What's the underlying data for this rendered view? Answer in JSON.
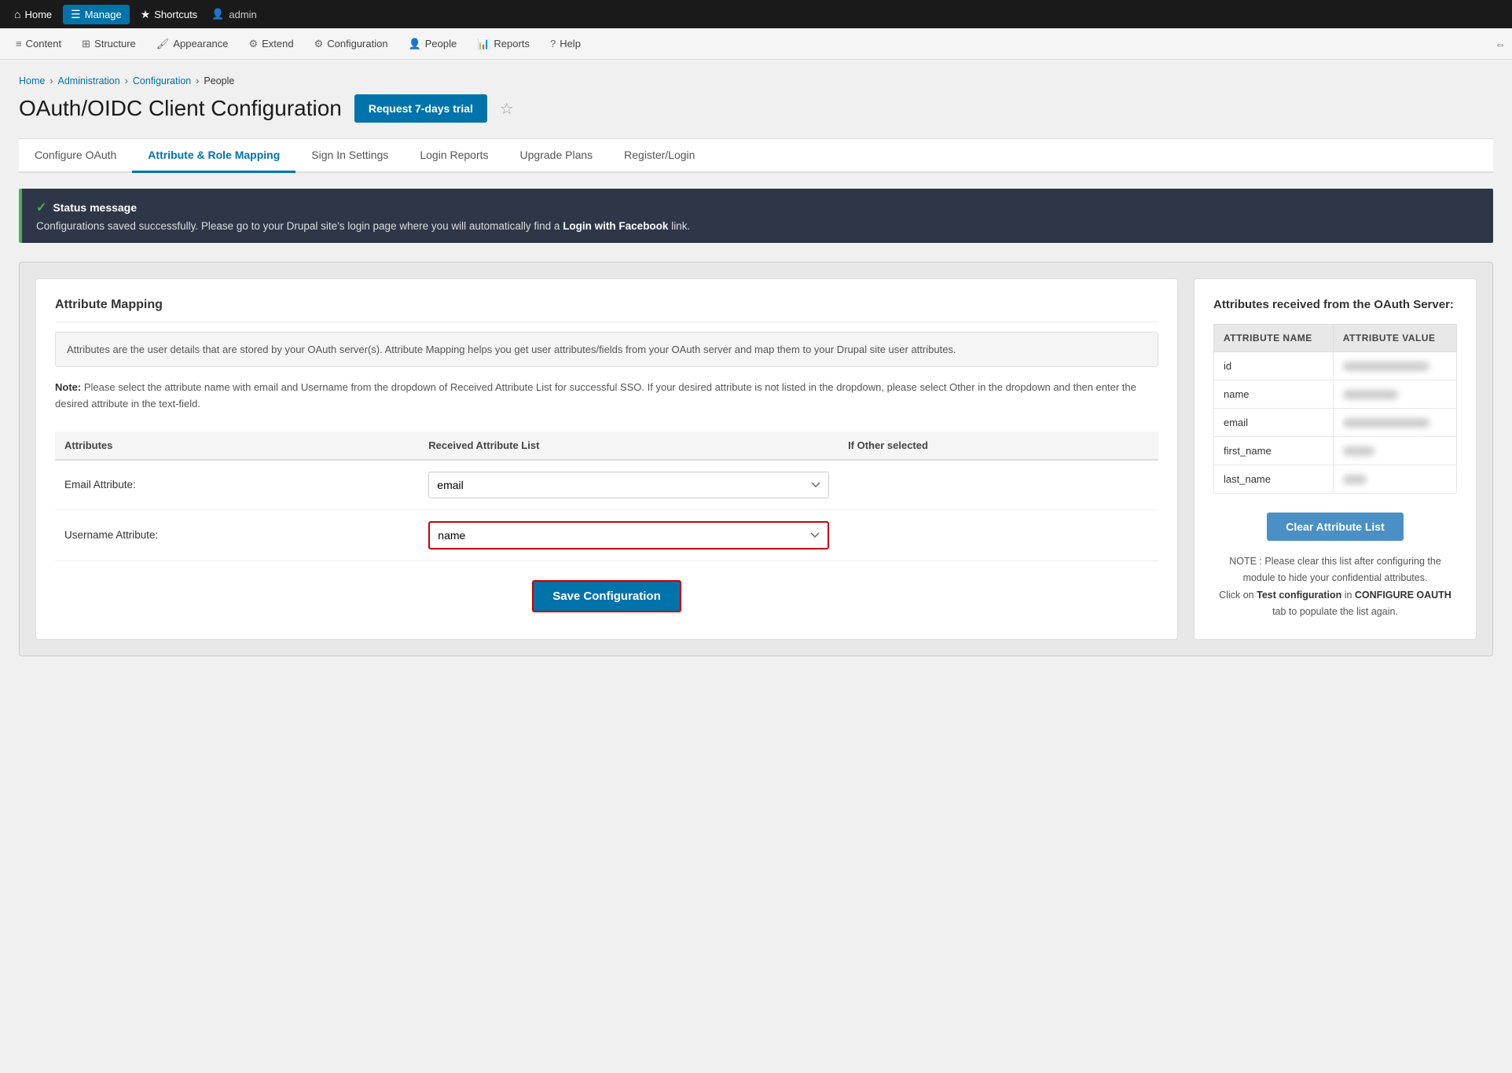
{
  "topnav": {
    "items": [
      {
        "id": "home",
        "label": "Home",
        "icon": "⌂",
        "active": false
      },
      {
        "id": "manage",
        "label": "Manage",
        "icon": "☰",
        "active": true
      },
      {
        "id": "shortcuts",
        "label": "Shortcuts",
        "icon": "★",
        "active": false
      }
    ],
    "user": {
      "label": "admin"
    }
  },
  "adminbar": {
    "items": [
      {
        "id": "content",
        "label": "Content",
        "icon": "≡"
      },
      {
        "id": "structure",
        "label": "Structure",
        "icon": "⊞"
      },
      {
        "id": "appearance",
        "label": "Appearance",
        "icon": "🖌"
      },
      {
        "id": "extend",
        "label": "Extend",
        "icon": "⚙"
      },
      {
        "id": "configuration",
        "label": "Configuration",
        "icon": "⚙"
      },
      {
        "id": "people",
        "label": "People",
        "icon": "👤"
      },
      {
        "id": "reports",
        "label": "Reports",
        "icon": "📊"
      },
      {
        "id": "help",
        "label": "Help",
        "icon": "?"
      }
    ]
  },
  "breadcrumb": {
    "items": [
      {
        "label": "Home",
        "link": true
      },
      {
        "label": "Administration",
        "link": true
      },
      {
        "label": "Configuration",
        "link": true
      },
      {
        "label": "People",
        "link": false
      }
    ]
  },
  "page": {
    "title": "OAuth/OIDC Client Configuration",
    "trial_btn": "Request 7-days trial"
  },
  "tabs": [
    {
      "id": "configure-oauth",
      "label": "Configure OAuth",
      "active": false
    },
    {
      "id": "attribute-role",
      "label": "Attribute & Role Mapping",
      "active": true
    },
    {
      "id": "sign-in",
      "label": "Sign In Settings",
      "active": false
    },
    {
      "id": "login-reports",
      "label": "Login Reports",
      "active": false
    },
    {
      "id": "upgrade-plans",
      "label": "Upgrade Plans",
      "active": false
    },
    {
      "id": "register-login",
      "label": "Register/Login",
      "active": false
    }
  ],
  "status": {
    "title": "Status message",
    "message_start": "Configurations saved successfully. Please go to your Drupal site's login page where you will automatically find a ",
    "message_link": "Login with Facebook",
    "message_end": " link."
  },
  "left_panel": {
    "section_title": "Attribute Mapping",
    "info_text": "Attributes are the user details that are stored by your OAuth server(s). Attribute Mapping helps you get user attributes/fields from your OAuth server and map them to your Drupal site user attributes.",
    "note_label": "Note:",
    "note_text": "Please select the attribute name with email and Username from the dropdown of Received Attribute List for successful SSO. If your desired attribute is not listed in the dropdown, please select Other in the dropdown and then enter the desired attribute in the text-field.",
    "table": {
      "col1": "Attributes",
      "col2": "Received Attribute List",
      "col3": "If Other selected",
      "rows": [
        {
          "attr_label": "Email Attribute:",
          "dropdown_value": "email",
          "highlighted": false
        },
        {
          "attr_label": "Username Attribute:",
          "dropdown_value": "name",
          "highlighted": true
        }
      ]
    },
    "save_btn": "Save Configuration"
  },
  "right_panel": {
    "title": "Attributes received from the OAuth Server:",
    "table": {
      "col1": "ATTRIBUTE NAME",
      "col2": "ATTRIBUTE VALUE",
      "rows": [
        {
          "name": "id",
          "value_length": "long"
        },
        {
          "name": "name",
          "value_length": "medium"
        },
        {
          "name": "email",
          "value_length": "long"
        },
        {
          "name": "first_name",
          "value_length": "short"
        },
        {
          "name": "last_name",
          "value_length": "vshort"
        }
      ]
    },
    "clear_btn": "Clear Attribute List",
    "note_start": "NOTE : Please clear this list after configuring the module to hide your confidential attributes.",
    "note_mid": "Click on ",
    "note_bold1": "Test configuration",
    "note_mid2": " in ",
    "note_bold2": "CONFIGURE OAUTH",
    "note_end": " tab to populate the list again."
  }
}
